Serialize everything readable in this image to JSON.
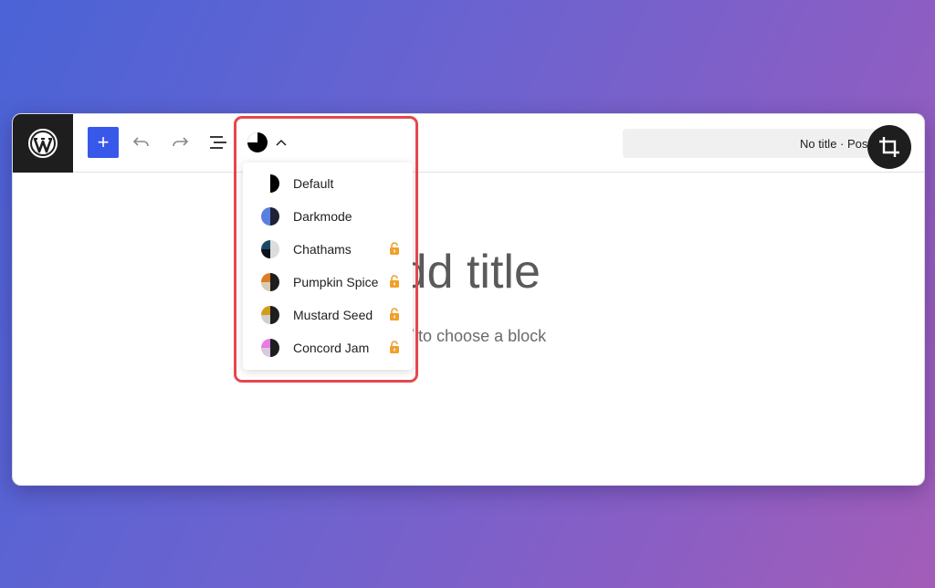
{
  "toolbar": {
    "add_label": "+",
    "doc_title": "No title · Post"
  },
  "editor": {
    "title_placeholder": "Add title",
    "block_placeholder": "Type / to choose a block"
  },
  "style_menu": {
    "items": [
      {
        "label": "Default",
        "locked": false,
        "colors": [
          "#000000",
          "#ffffff",
          "#ffffff",
          "#000000"
        ]
      },
      {
        "label": "Darkmode",
        "locked": false,
        "colors": [
          "#1e2235",
          "#5b7fe0",
          "#5b7fe0",
          "#1e2235"
        ]
      },
      {
        "label": "Chathams",
        "locked": true,
        "colors": [
          "#dcdcdc",
          "#1b4965",
          "#0b1118",
          "#dcdcdc"
        ]
      },
      {
        "label": "Pumpkin Spice",
        "locked": true,
        "colors": [
          "#1e1e1e",
          "#e07b24",
          "#d8cbb5",
          "#1e1e1e"
        ]
      },
      {
        "label": "Mustard Seed",
        "locked": true,
        "colors": [
          "#1e1e1e",
          "#d49a1a",
          "#cfcfcf",
          "#1e1e1e"
        ]
      },
      {
        "label": "Concord Jam",
        "locked": true,
        "colors": [
          "#1e1e1e",
          "#e879e6",
          "#d8c8e0",
          "#1e1e1e"
        ]
      }
    ]
  },
  "colors": {
    "accent": "#3858e9",
    "highlight": "#e5474d",
    "lock": "#f0a02b"
  }
}
